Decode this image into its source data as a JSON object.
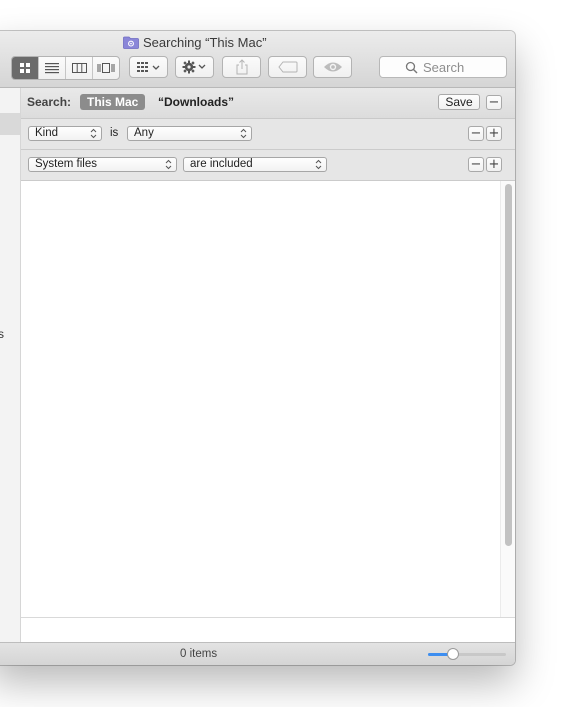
{
  "window": {
    "title": "Searching “This Mac”"
  },
  "toolbar": {
    "view_modes": [
      {
        "name": "icon-view-icon",
        "active": true
      },
      {
        "name": "list-view-icon",
        "active": false
      },
      {
        "name": "column-view-icon",
        "active": false
      },
      {
        "name": "cover-flow-view-icon",
        "active": false
      }
    ],
    "arrange_icon": "arrange-grid-icon",
    "action_icon": "gear-icon",
    "share_icon": "share-icon",
    "tag_icon": "tag-icon",
    "quicklook_icon": "eye-icon",
    "search_placeholder": "Search"
  },
  "sidebar": {
    "partial_label": "s"
  },
  "scope_bar": {
    "label": "Search:",
    "scope_selected": "This Mac",
    "scope_other": "“Downloads”",
    "save_label": "Save",
    "remove_label": "−"
  },
  "rules": [
    {
      "attribute": "Kind",
      "operator": "is",
      "value": "Any",
      "remove_label": "−",
      "add_label": "+"
    },
    {
      "attribute": "System files",
      "value": "are included",
      "remove_label": "−",
      "add_label": "+"
    }
  ],
  "status": {
    "items_text": "0 items",
    "icon_size_level": 0.32
  },
  "colors": {
    "accent": "#3d8ef0",
    "selected_scope": "#8c8c8c"
  }
}
